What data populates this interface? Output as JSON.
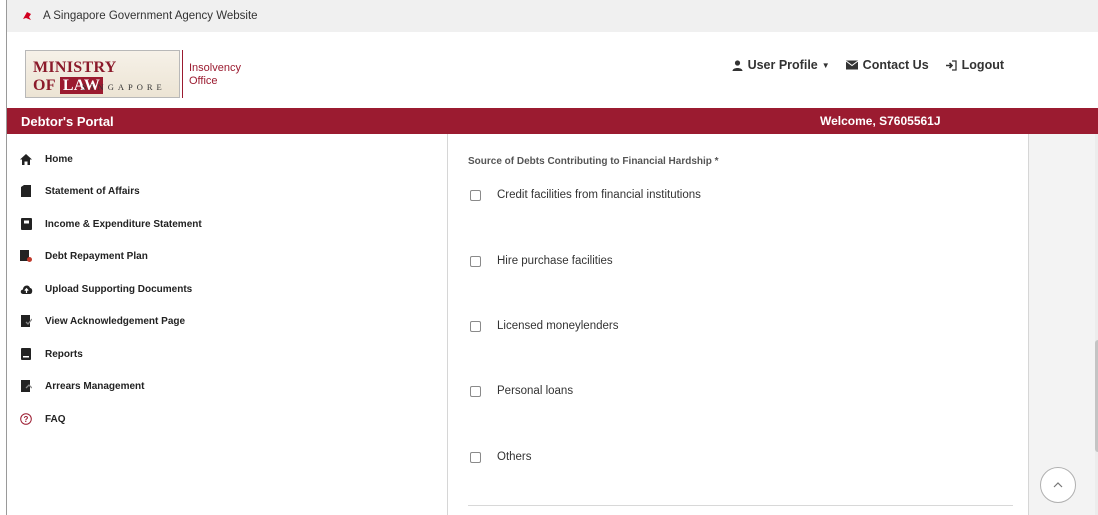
{
  "gov_banner": {
    "text": "A Singapore Government Agency Website"
  },
  "logo": {
    "main_text": "MINISTRY OF",
    "law_text": "LAW",
    "sub_text": "SINGAPORE",
    "side_line1": "Insolvency",
    "side_line2": "Office"
  },
  "top_nav": {
    "user_profile": "User Profile",
    "contact_us": "Contact Us",
    "logout": "Logout"
  },
  "portal_bar": {
    "title": "Debtor's Portal",
    "welcome": "Welcome, S7605561J"
  },
  "sidebar": {
    "items": [
      {
        "label": "Home",
        "icon": "home-icon"
      },
      {
        "label": "Statement of Affairs",
        "icon": "document-icon"
      },
      {
        "label": "Income & Expenditure Statement",
        "icon": "ledger-icon"
      },
      {
        "label": "Debt Repayment Plan",
        "icon": "plan-icon"
      },
      {
        "label": "Upload Supporting Documents",
        "icon": "cloud-upload-icon"
      },
      {
        "label": "View Acknowledgement Page",
        "icon": "acknowledgement-icon"
      },
      {
        "label": "Reports",
        "icon": "reports-icon"
      },
      {
        "label": "Arrears Management",
        "icon": "arrears-icon"
      },
      {
        "label": "FAQ",
        "icon": "question-icon"
      }
    ]
  },
  "form": {
    "field_label": "Source of Debts Contributing to Financial Hardship *",
    "options": [
      {
        "label": "Credit facilities from financial institutions",
        "checked": false
      },
      {
        "label": "Hire purchase facilities",
        "checked": false
      },
      {
        "label": "Licensed moneylenders",
        "checked": false
      },
      {
        "label": "Personal loans",
        "checked": false
      },
      {
        "label": "Others",
        "checked": false
      }
    ]
  },
  "colors": {
    "brand": "#9b1b30",
    "banner_bg": "#f0f0f0"
  }
}
